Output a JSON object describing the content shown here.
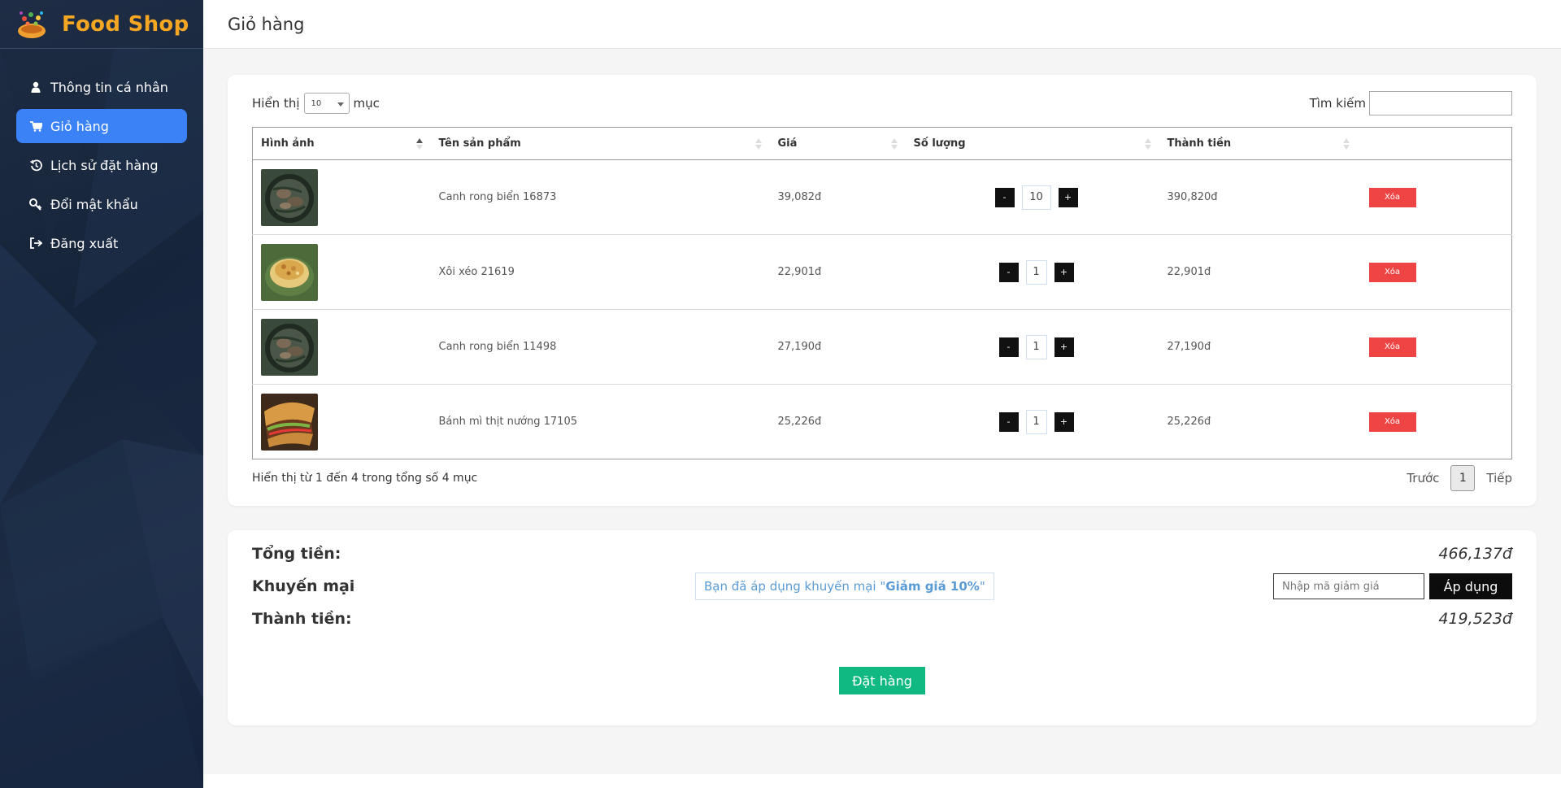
{
  "brand": {
    "title": "Food Shop",
    "logo_icon": "food-basket-logo"
  },
  "sidebar": {
    "items": [
      {
        "label": "Thông tin cá nhân",
        "icon": "user-icon",
        "active": false
      },
      {
        "label": "Giỏ hàng",
        "icon": "cart-icon",
        "active": true
      },
      {
        "label": "Lịch sử đặt hàng",
        "icon": "history-icon",
        "active": false
      },
      {
        "label": "Đổi mật khẩu",
        "icon": "key-icon",
        "active": false
      },
      {
        "label": "Đăng xuất",
        "icon": "logout-icon",
        "active": false
      }
    ]
  },
  "header": {
    "title": "Giỏ hàng"
  },
  "table_controls": {
    "length_prefix": "Hiển thị",
    "length_value": "10",
    "length_suffix": "mục",
    "search_label": "Tìm kiếm",
    "search_value": ""
  },
  "table": {
    "columns": [
      "Hình ảnh",
      "Tên sản phẩm",
      "Giá",
      "Số lượng",
      "Thành tiền",
      ""
    ],
    "rows": [
      {
        "image": "seaweed-soup",
        "name": "Canh rong biển 16873",
        "price": "39,082đ",
        "qty": "10",
        "total": "390,820đ",
        "delete": "Xóa"
      },
      {
        "image": "xoi-xeo",
        "name": "Xôi xéo 21619",
        "price": "22,901đ",
        "qty": "1",
        "total": "22,901đ",
        "delete": "Xóa"
      },
      {
        "image": "seaweed-soup",
        "name": "Canh rong biển 11498",
        "price": "27,190đ",
        "qty": "1",
        "total": "27,190đ",
        "delete": "Xóa"
      },
      {
        "image": "banh-mi",
        "name": "Bánh mì thịt nướng 17105",
        "price": "25,226đ",
        "qty": "1",
        "total": "25,226đ",
        "delete": "Xóa"
      }
    ],
    "minus_label": "-",
    "plus_label": "+"
  },
  "table_footer": {
    "info": "Hiển thị từ 1 đến 4 trong tổng số 4 mục",
    "prev": "Trước",
    "page": "1",
    "next": "Tiếp"
  },
  "summary": {
    "total_label": "Tổng tiền:",
    "total_value": "466,137đ",
    "promo_label": "Khuyến mại",
    "promo_msg_prefix": "Bạn đã áp dụng khuyến mại \"",
    "promo_msg_name": "Giảm giá 10%",
    "promo_msg_suffix": "\"",
    "promo_placeholder": "Nhập mã giảm giá",
    "apply_label": "Áp dụng",
    "final_label": "Thành tiền:",
    "final_value": "419,523đ",
    "order_label": "Đặt hàng"
  },
  "colors": {
    "brand": "#f5a623",
    "sidebar_bg": "#1b2a42",
    "active_nav": "#3b82f6",
    "delete": "#ef4444",
    "order": "#10b981",
    "promo_text": "#5b9bd5"
  }
}
